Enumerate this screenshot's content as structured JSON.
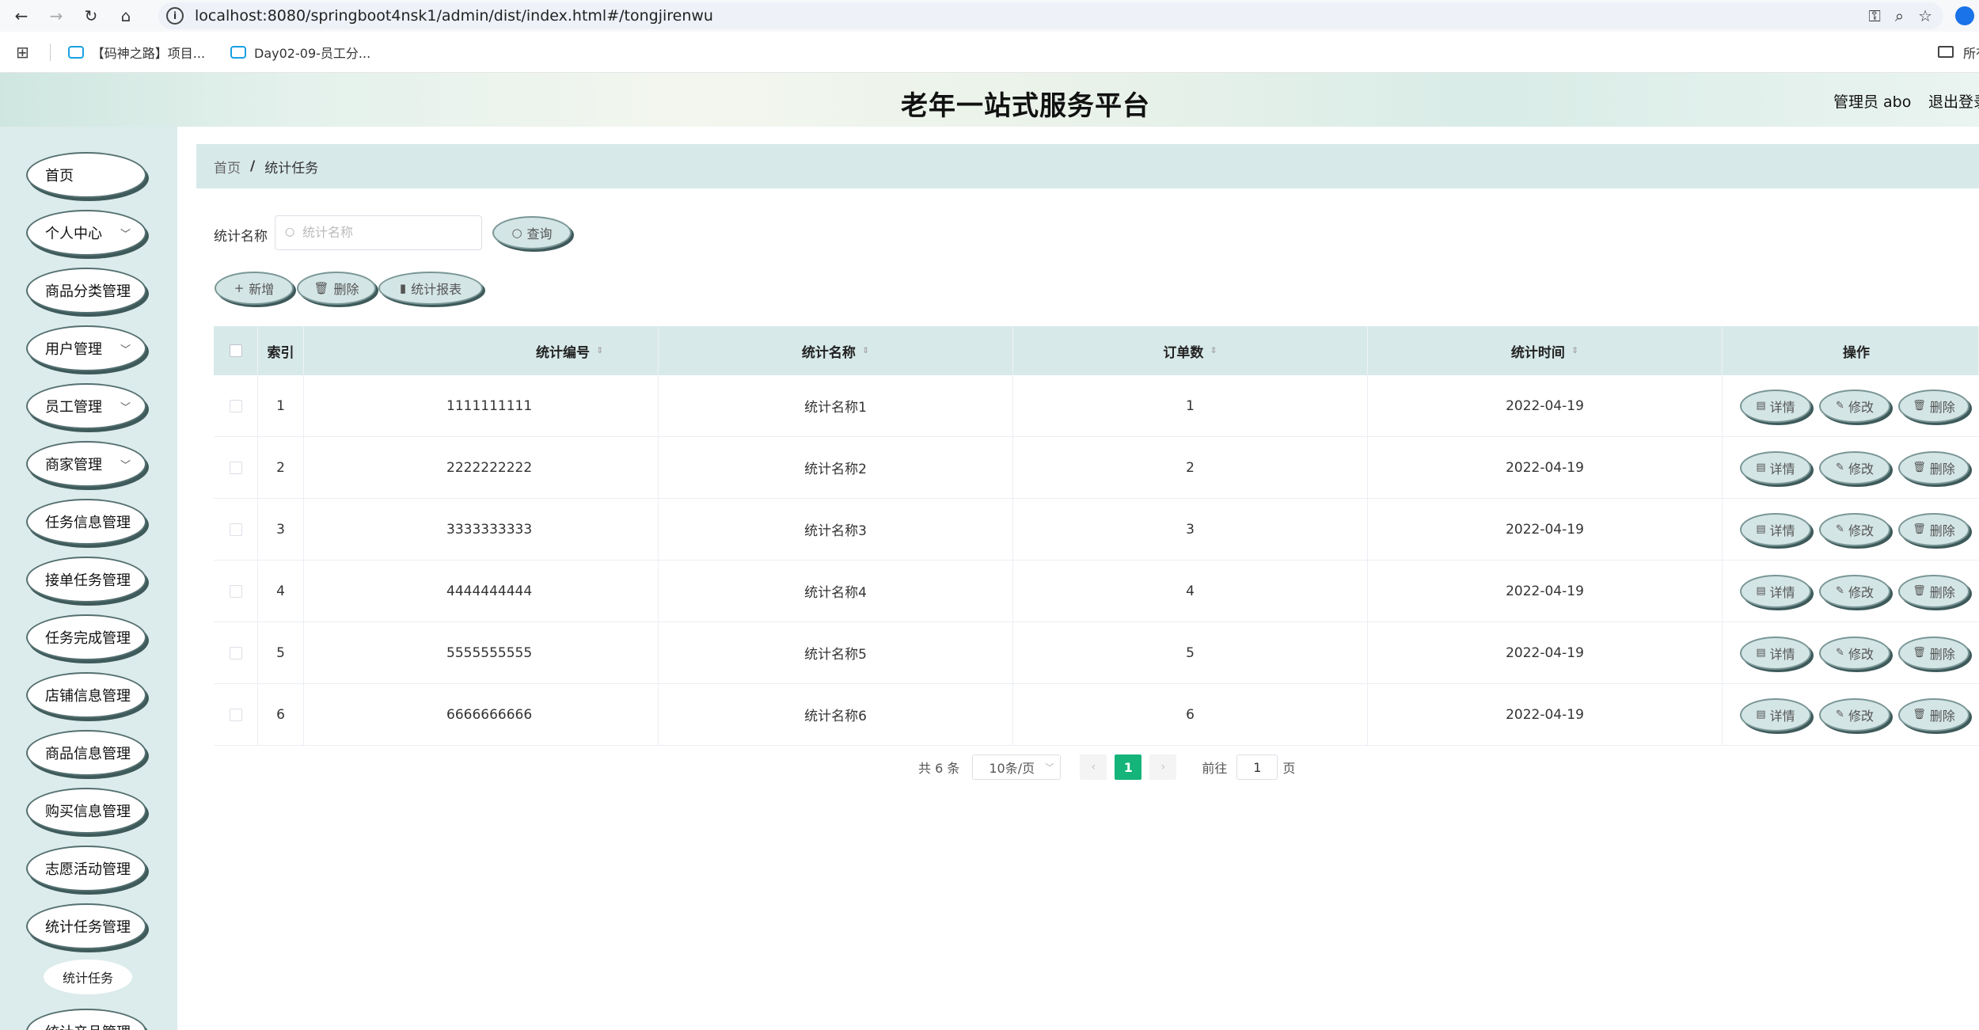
{
  "browser": {
    "url": "localhost:8080/springboot4nsk1/admin/dist/index.html#/tongjirenwu",
    "bookmarks": [
      "【码神之路】项目...",
      "Day02-09-员工分..."
    ],
    "bookmarks_right": "所有"
  },
  "header": {
    "title": "老年一站式服务平台",
    "admin": "管理员 abo",
    "logout": "退出登录"
  },
  "sidebar": {
    "items": [
      {
        "label": "首页",
        "chevron": false
      },
      {
        "label": "个人中心",
        "chevron": true
      },
      {
        "label": "商品分类管理",
        "chevron": false
      },
      {
        "label": "用户管理",
        "chevron": true
      },
      {
        "label": "员工管理",
        "chevron": true
      },
      {
        "label": "商家管理",
        "chevron": true
      },
      {
        "label": "任务信息管理",
        "chevron": false
      },
      {
        "label": "接单任务管理",
        "chevron": false
      },
      {
        "label": "任务完成管理",
        "chevron": false
      },
      {
        "label": "店铺信息管理",
        "chevron": false
      },
      {
        "label": "商品信息管理",
        "chevron": false
      },
      {
        "label": "购买信息管理",
        "chevron": false
      },
      {
        "label": "志愿活动管理",
        "chevron": false
      },
      {
        "label": "统计任务管理",
        "chevron": false
      }
    ],
    "subitem": "统计任务",
    "last_item": "统计产品管理"
  },
  "breadcrumb": {
    "home": "首页",
    "sep": "/",
    "current": "统计任务"
  },
  "search": {
    "label": "统计名称",
    "placeholder": "统计名称",
    "button": "查询"
  },
  "toolbar": {
    "add": "新增",
    "delete": "删除",
    "report": "统计报表"
  },
  "table": {
    "headers": {
      "index": "索引",
      "code": "统计编号",
      "name": "统计名称",
      "count": "订单数",
      "time": "统计时间",
      "ops": "操作"
    },
    "ops": {
      "detail": "详情",
      "edit": "修改",
      "delete": "删除"
    },
    "rows": [
      {
        "index": "1",
        "code": "1111111111",
        "name": "统计名称1",
        "count": "1",
        "time": "2022-04-19"
      },
      {
        "index": "2",
        "code": "2222222222",
        "name": "统计名称2",
        "count": "2",
        "time": "2022-04-19"
      },
      {
        "index": "3",
        "code": "3333333333",
        "name": "统计名称3",
        "count": "3",
        "time": "2022-04-19"
      },
      {
        "index": "4",
        "code": "4444444444",
        "name": "统计名称4",
        "count": "4",
        "time": "2022-04-19"
      },
      {
        "index": "5",
        "code": "5555555555",
        "name": "统计名称5",
        "count": "5",
        "time": "2022-04-19"
      },
      {
        "index": "6",
        "code": "6666666666",
        "name": "统计名称6",
        "count": "6",
        "time": "2022-04-19"
      }
    ]
  },
  "pagination": {
    "total": "共 6 条",
    "page_size": "10条/页",
    "current": "1",
    "goto": "前往",
    "goto_value": "1",
    "page_unit": "页"
  },
  "colors": {
    "accent": "#14b47a",
    "sidebar_bg": "#dcebeb",
    "header_row_bg": "#d8e9e9"
  }
}
